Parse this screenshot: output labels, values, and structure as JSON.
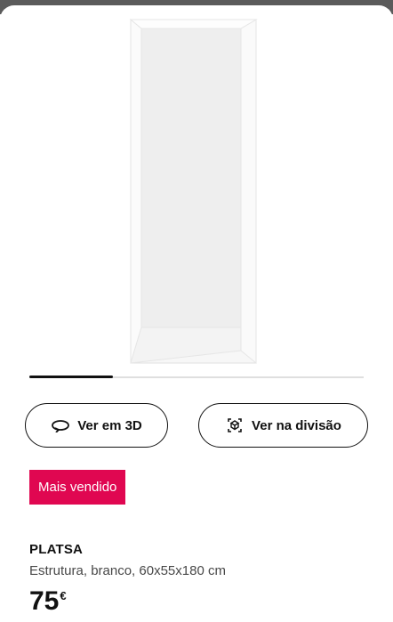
{
  "colors": {
    "badge_bg": "#e00751",
    "badge_text": "#ffffff",
    "text_primary": "#111111",
    "text_secondary": "#484848"
  },
  "carousel": {
    "progress_fraction": 0.25
  },
  "buttons": {
    "view_3d": {
      "label": "Ver em 3D",
      "icon": "rotate-3d-icon"
    },
    "view_in_room": {
      "label": "Ver na divisão",
      "icon": "ar-view-icon"
    }
  },
  "badge": {
    "label": "Mais vendido"
  },
  "product": {
    "name": "PLATSA",
    "description": "Estrutura, branco, 60x55x180 cm",
    "price": "75",
    "currency": "€"
  }
}
